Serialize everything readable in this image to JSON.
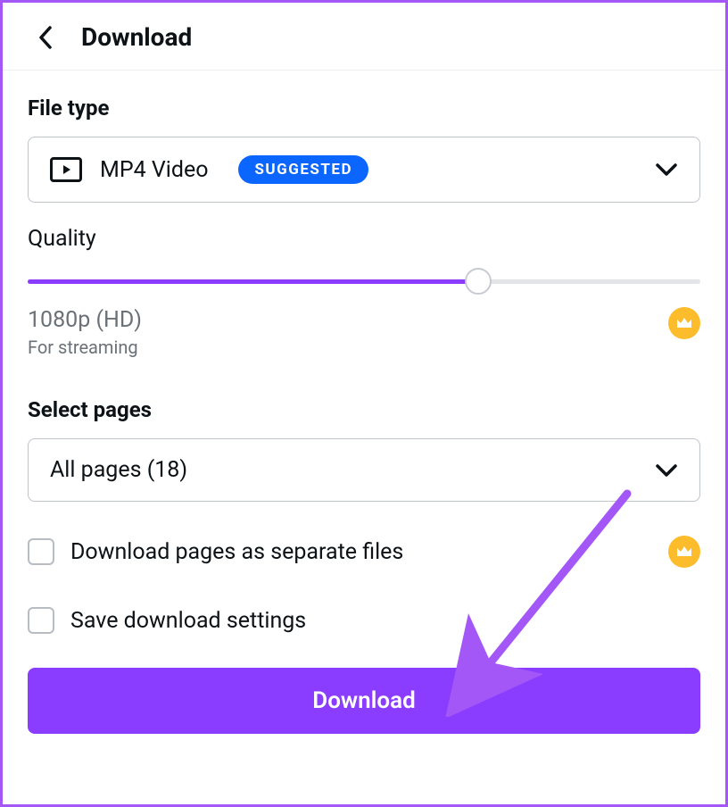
{
  "header": {
    "title": "Download"
  },
  "file_type": {
    "label": "File type",
    "selected": "MP4 Video",
    "badge": "SUGGESTED"
  },
  "quality": {
    "label": "Quality",
    "value": "1080p (HD)",
    "desc": "For streaming",
    "slider_percent": 67
  },
  "pages": {
    "label": "Select pages",
    "selected": "All pages (18)"
  },
  "checkboxes": {
    "separate_files": "Download pages as separate files",
    "save_settings": "Save download settings"
  },
  "buttons": {
    "download": "Download"
  },
  "colors": {
    "accent": "#8b3dff",
    "badge_blue": "#0a66ff",
    "crown": "#fdbc2c"
  }
}
